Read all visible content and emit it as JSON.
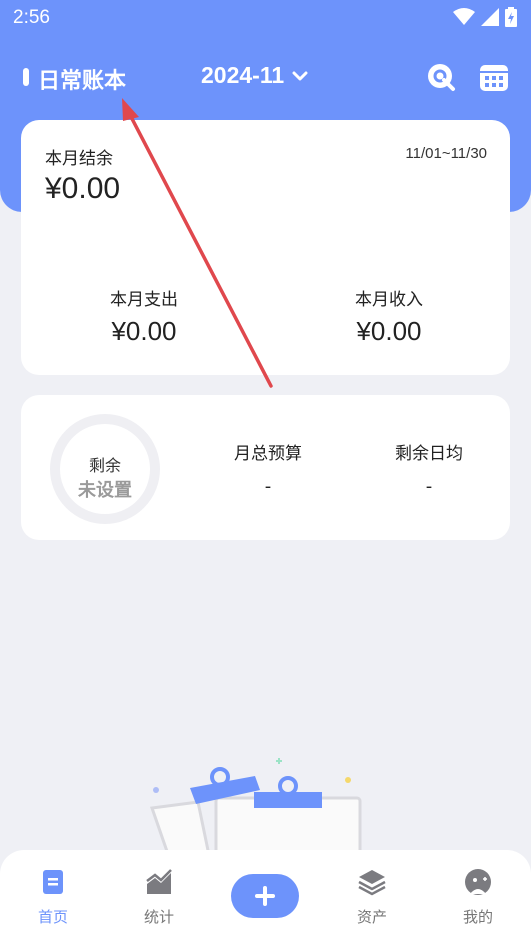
{
  "status_bar": {
    "time": "2:56"
  },
  "header": {
    "book_name": "日常账本",
    "month": "2024-11"
  },
  "summary": {
    "balance_label": "本月结余",
    "date_range": "11/01~11/30",
    "balance_value": "¥0.00",
    "expense_label": "本月支出",
    "expense_value": "¥0.00",
    "income_label": "本月收入",
    "income_value": "¥0.00"
  },
  "budget": {
    "remaining_label": "剩余",
    "remaining_status": "未设置",
    "total_label": "月总预算",
    "total_value": "-",
    "daily_label": "剩余日均",
    "daily_value": "-"
  },
  "nav": {
    "items": [
      {
        "label": "首页",
        "icon": "home-icon",
        "active": true
      },
      {
        "label": "统计",
        "icon": "chart-icon",
        "active": false
      },
      {
        "label": "资产",
        "icon": "layers-icon",
        "active": false
      },
      {
        "label": "我的",
        "icon": "profile-icon",
        "active": false
      }
    ],
    "add_icon": "plus-icon"
  },
  "colors": {
    "accent": "#6d93fb",
    "background": "#eff0f5",
    "annotation": "#e0484d"
  }
}
